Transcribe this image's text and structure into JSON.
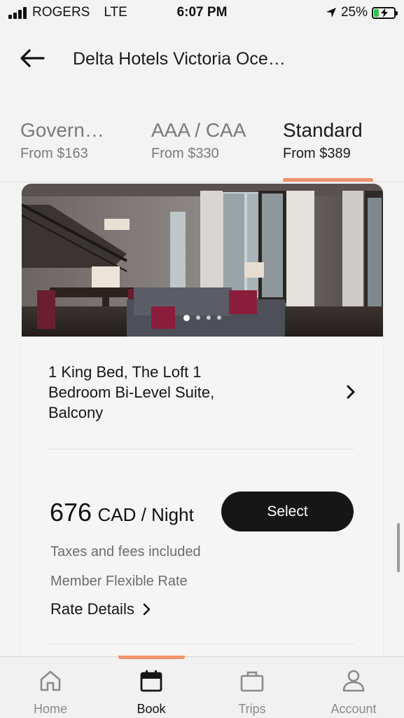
{
  "status_bar": {
    "carrier": "ROGERS",
    "network": "LTE",
    "time": "6:07 PM",
    "battery": "25%"
  },
  "header": {
    "back_icon": "arrow-left-icon",
    "title": "Delta Hotels Victoria Oce…"
  },
  "rate_tabs": [
    {
      "name": "Govern…",
      "price": "From $163",
      "active": false
    },
    {
      "name": "AAA / CAA",
      "price": "From $330",
      "active": false
    },
    {
      "name": "Standard",
      "price": "From $389",
      "active": true
    }
  ],
  "room": {
    "photo_description_icon": "room-photo",
    "carousel_count": 4,
    "carousel_active": 0,
    "title_lines": [
      "1 King Bed, The Loft 1",
      "Bedroom Bi-Level Suite,",
      "Balcony"
    ],
    "chevron_icon": "chevron-right-icon"
  },
  "rate": {
    "amount": "676",
    "unit": "CAD / Night",
    "select_label": "Select",
    "taxes_note": "Taxes and fees included",
    "rate_type": "Member Flexible Rate",
    "details_label": "Rate Details"
  },
  "bottom_nav": [
    {
      "label": "Home",
      "icon": "home-icon",
      "active": false
    },
    {
      "label": "Book",
      "icon": "calendar-icon",
      "active": true
    },
    {
      "label": "Trips",
      "icon": "briefcase-icon",
      "active": false
    },
    {
      "label": "Account",
      "icon": "person-icon",
      "active": false
    }
  ],
  "colors": {
    "accent": "#f0926a",
    "button": "#161616",
    "background": "#f2f3f2",
    "battery_charging": "#2ec24a"
  }
}
